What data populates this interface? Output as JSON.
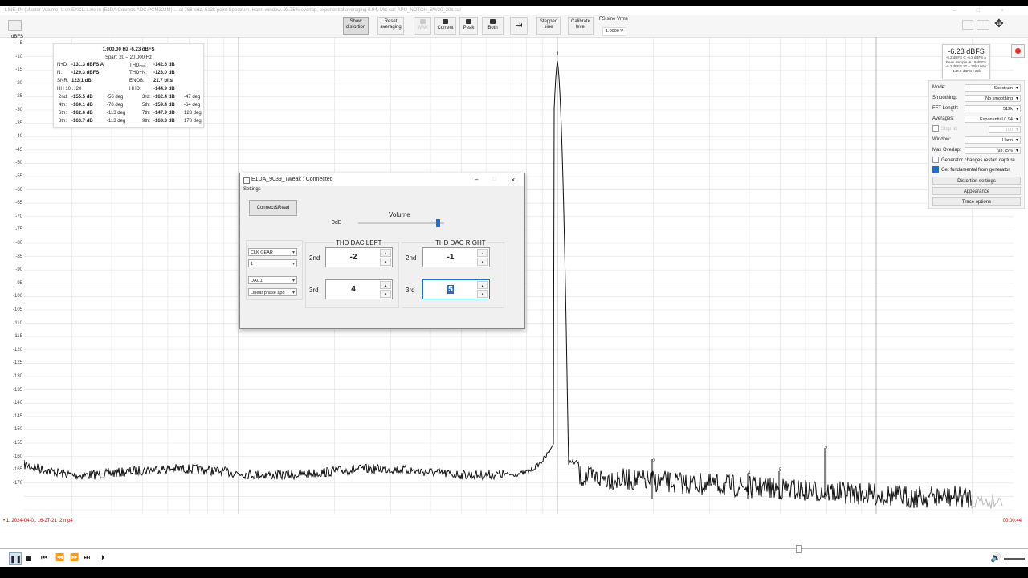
{
  "titlebar": {
    "text": "LINE_IN (Master Volume) L on EXCL: Line in (E1DA Cosmos ADC PCM32/IM) ... at 768 kHz, 512k-point Spectrum, Hann window, 93.75% overlap, exponential averaging 0.94, Mic cal: APU_NOTCH_BW20_20k.cal",
    "controls": "– □ ×"
  },
  "toolbar": {
    "yunit": "dBFS",
    "buttons": [
      {
        "label": "Show distortion"
      },
      {
        "label": "Reset averaging"
      },
      {
        "label": "WAV"
      },
      {
        "label": "Current"
      },
      {
        "label": "Peak"
      },
      {
        "label": "Both"
      },
      {
        "label": ""
      },
      {
        "label": "Stepped sine"
      },
      {
        "label": "Calibrate level"
      }
    ],
    "fs_sine_label": "FS sine Vrms",
    "fs_sine_value": "1.0000 V"
  },
  "y_axis": {
    "labels": [
      "-5",
      "-10",
      "-15",
      "-20",
      "-25",
      "-30",
      "-35",
      "-40",
      "-45",
      "-50",
      "-55",
      "-60",
      "-65",
      "-70",
      "-75",
      "-80",
      "-85",
      "-90",
      "-95",
      "-100",
      "-105",
      "-110",
      "-115",
      "-120",
      "-125",
      "-130",
      "-135",
      "-140",
      "-145",
      "-150",
      "-155",
      "-160",
      "-165",
      "-170"
    ]
  },
  "stats": {
    "header1": "1,000.00 Hz  -6.23 dBFS",
    "header2": "Span: 20 – 20,000 Hz",
    "rows": [
      {
        "l1": "N+D:",
        "v1": "-131.3 dBFS A",
        "l2": "THDₙₒₒ:",
        "v2": "-142.6 dB"
      },
      {
        "l1": "N:",
        "v1": "-129.3 dBFS",
        "l2": "THD+N:",
        "v2": "-123.0 dB"
      },
      {
        "l1": "SNR:",
        "v1": "123.1 dB",
        "l2": "ENOB:",
        "v2": "21.7 bits"
      },
      {
        "l1": "HH 10 .. 20",
        "v1": "",
        "l2": "HHD:",
        "v2": "-144.9 dB"
      }
    ],
    "harmonics": [
      {
        "a": "2nd:",
        "av": "-155.5 dB",
        "ad": "-56 deg",
        "b": "3rd:",
        "bv": "-162.4 dB",
        "bd": "-47 deg"
      },
      {
        "a": "4th:",
        "av": "-160.1 dB",
        "ad": "-78 deg",
        "b": "5th:",
        "bv": "-159.4 dB",
        "bd": "-64 deg"
      },
      {
        "a": "6th:",
        "av": "-162.6 dB",
        "ad": "-113 deg",
        "b": "7th:",
        "bv": "-147.9 dB",
        "bd": "123 deg"
      },
      {
        "a": "8th:",
        "av": "-163.7 dB",
        "ad": "-113 deg",
        "b": "9th:",
        "bv": "-163.3 dB",
        "bd": "178 deg"
      }
    ]
  },
  "level": {
    "big": "-6.23 dBFS",
    "l1": "-6.2 dBFS C  -6.2 dBFS A",
    "l2": "Peak sample -6.19 dBFS",
    "l3": "-6.2 dBFS 22 – 20k UNW",
    "l4": "-144.9 dBFS +22k"
  },
  "settings": {
    "rows": [
      {
        "label": "Mode:",
        "value": "Spectrum"
      },
      {
        "label": "Smoothing:",
        "value": "No smoothing"
      },
      {
        "label": "FFT Length:",
        "value": "512k"
      },
      {
        "label": "Averages:",
        "value": "Exponential 0.94"
      },
      {
        "label": "Stop at:",
        "value": "100"
      },
      {
        "label": "Window:",
        "value": "Hann"
      },
      {
        "label": "Max Overlap:",
        "value": "93.75%"
      }
    ],
    "check1": "Generator changes restart capture",
    "check2": "Get fundamental from generator",
    "btn1": "Distortion settings",
    "btn2": "Appearance",
    "btn3": "Trace options"
  },
  "dialog": {
    "title": "E1DA_9039_Tweak : Connected",
    "menu": "Settings",
    "connect": "Connect&Read",
    "volume_label": "Volume",
    "volume_value": "0dB",
    "volume_level": 0.95,
    "combo1": "CLK GEAR",
    "combo2": "1",
    "combo3": "DAC1",
    "combo4": "Linear phase apo",
    "left_title": "THD DAC LEFT",
    "right_title": "THD DAC RIGHT",
    "second": "2nd",
    "third": "3rd",
    "left_2nd": "-2",
    "left_3rd": "4",
    "right_2nd": "-1",
    "right_3rd": "5"
  },
  "spectrum": {
    "peak_marker": "1",
    "harmonic_markers": [
      "2",
      "4",
      "5",
      "7"
    ]
  },
  "bottom": {
    "filename": "• 1. 2024-04-01 16-27-21_2.mp4",
    "timecode": "00:00:44"
  }
}
